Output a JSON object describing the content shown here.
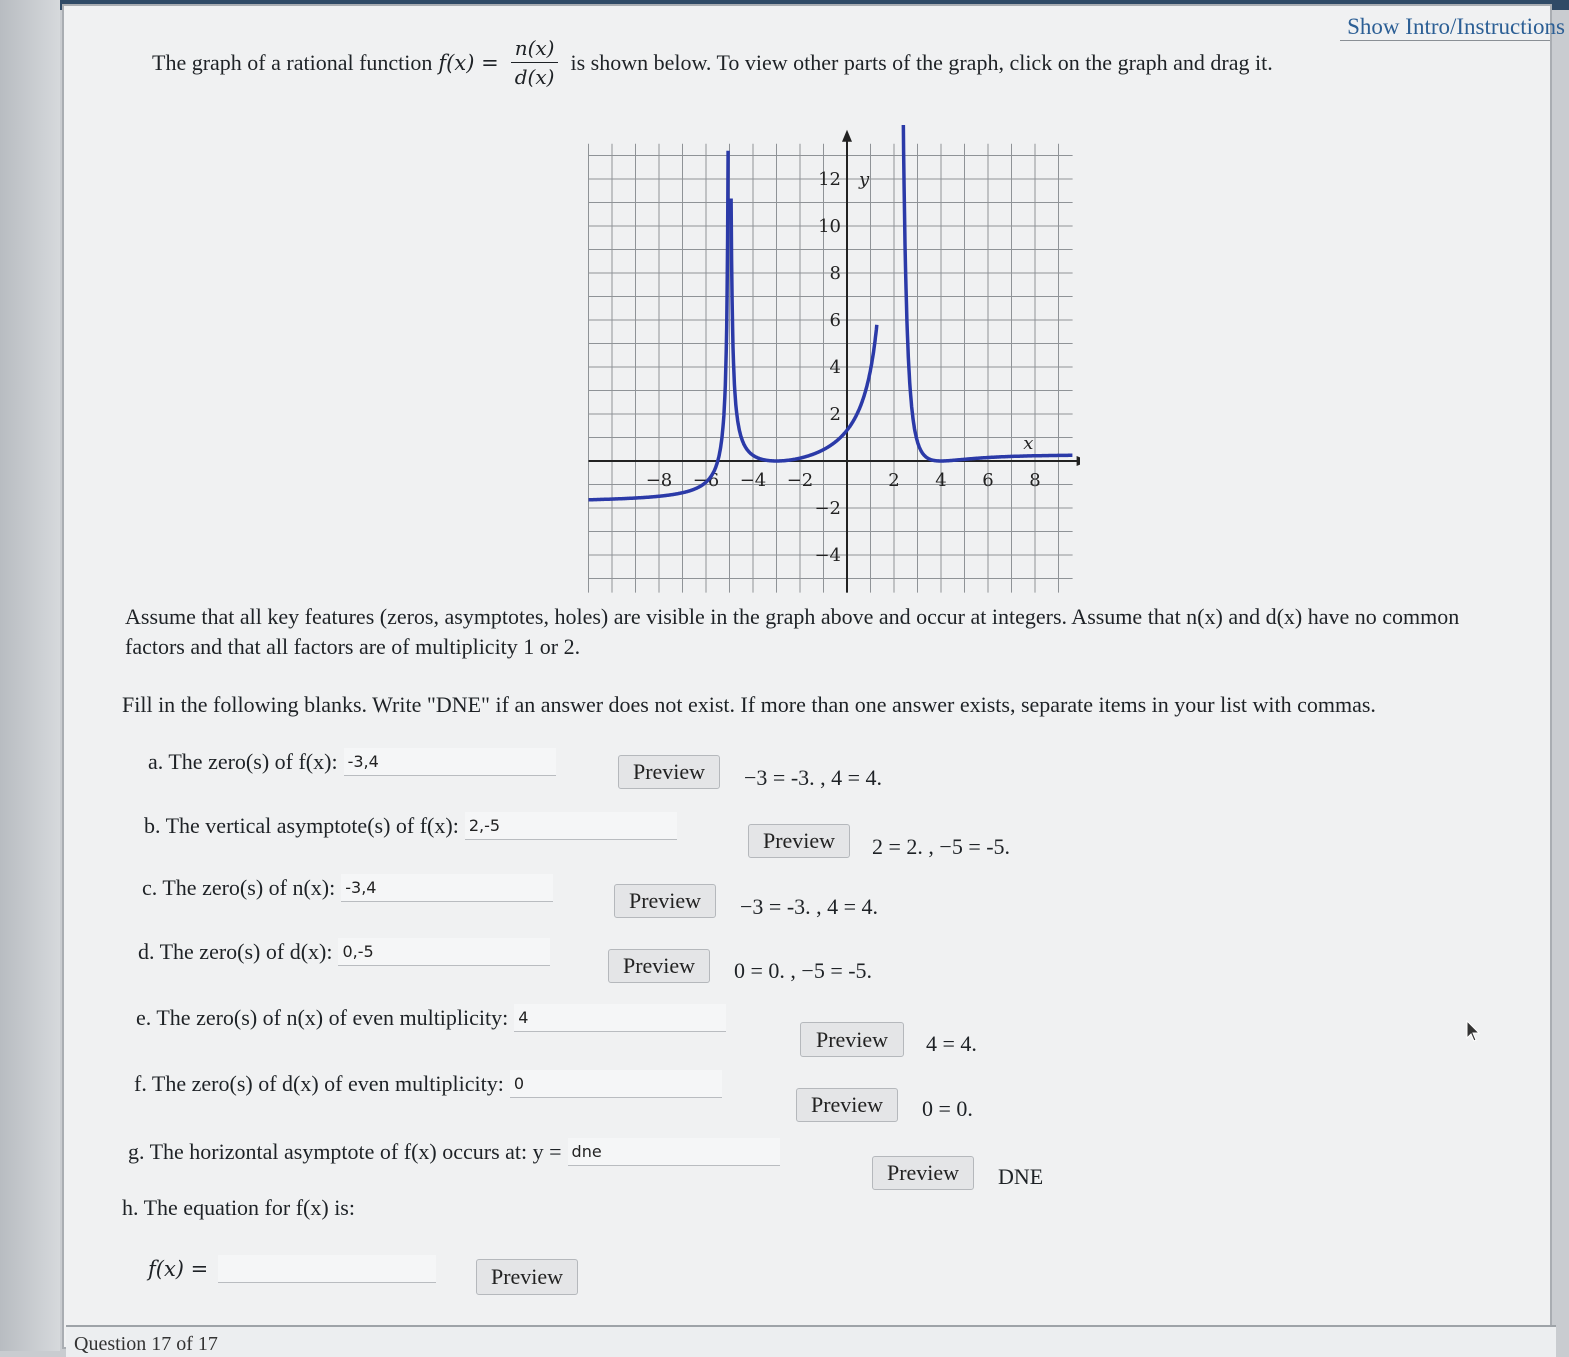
{
  "intro_link": "Show Intro/Instructions",
  "prompt": {
    "before": "The graph of a rational function",
    "fx": "f(x) =",
    "numerator": "n(x)",
    "denominator": "d(x)",
    "after": "is shown below. To view other parts of the graph, click on the graph and drag it."
  },
  "graph": {
    "x_ticks": [
      "−8",
      "−6",
      "−4",
      "−2",
      "2",
      "4",
      "6",
      "8"
    ],
    "y_ticks_pos": [
      "2",
      "4",
      "6",
      "8",
      "10",
      "12"
    ],
    "y_ticks_neg": [
      "−2",
      "−4"
    ],
    "x_label": "x",
    "y_label": "y",
    "curve_color": "#2b3aa8"
  },
  "assume": "Assume that all key features (zeros, asymptotes, holes) are visible in the graph above and occur at integers. Assume that n(x) and d(x) have no common factors and that all factors are of multiplicity 1 or 2.",
  "fill": "Fill in the following blanks. Write \"DNE\" if an answer does not exist. If more than one answer exists, separate items in your list with commas.",
  "preview_label": "Preview",
  "items": [
    {
      "label": "a. The zero(s) of f(x):",
      "value": "-3,4",
      "output": "−3 = -3. , 4 = 4."
    },
    {
      "label": "b. The vertical asymptote(s) of f(x):",
      "value": "2,-5",
      "output": "2 = 2. , −5 = -5."
    },
    {
      "label": "c. The zero(s) of n(x):",
      "value": "-3,4",
      "output": "−3 = -3. , 4 = 4."
    },
    {
      "label": "d. The zero(s) of d(x):",
      "value": "0,-5",
      "output": "0 = 0. , −5 = -5."
    },
    {
      "label": "e. The zero(s) of n(x) of even multiplicity:",
      "value": "4",
      "output": "4 = 4."
    },
    {
      "label": "f. The zero(s) of d(x) of even multiplicity:",
      "value": "0",
      "output": "0 = 0."
    },
    {
      "label": "g. The horizontal asymptote of f(x) occurs at: y =",
      "value": "dne",
      "output": "DNE"
    },
    {
      "label": "h. The equation for f(x) is:",
      "value": "",
      "output": ""
    }
  ],
  "equation_label": "f(x) =",
  "question_label": "Question 17 of 17"
}
